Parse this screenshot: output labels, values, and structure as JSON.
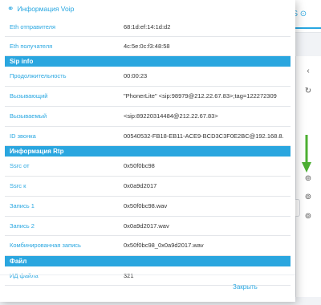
{
  "background": {
    "tab_label": "2 S",
    "tab_icon": "gear-icon",
    "side_icons": [
      "chevron-left-icon",
      "refresh-icon",
      "help-icon",
      "help-icon",
      "help-icon"
    ]
  },
  "modal": {
    "title": "Информация Voip",
    "title_icon": "link-icon",
    "close_label": "Закрыть",
    "rows": [
      {
        "type": "row",
        "label": "Eth отправителя",
        "value": "68:1d:ef:14:1d:d2"
      },
      {
        "type": "row",
        "label": "Eth получателя",
        "value": "4c:5e:0c:f3:48:58"
      },
      {
        "type": "section",
        "label": "Sip info"
      },
      {
        "type": "row",
        "label": "Продолжительность",
        "value": "00:00:23"
      },
      {
        "type": "row",
        "label": "Вызывающий",
        "value": "\"PhonerLite\" <sip:98979@212.22.67.83>;tag=122272309"
      },
      {
        "type": "row",
        "label": "Вызываемый",
        "value": "<sip:89220314484@212.22.67.83>"
      },
      {
        "type": "row",
        "label": "ID звонка",
        "value": "00540532-FB18-EB11-ACE9-BCD3C3F0E2BC@192.168.8."
      },
      {
        "type": "section",
        "label": "Информация Rtp"
      },
      {
        "type": "row",
        "label": "Ssrc от",
        "value": "0x50f0bc98"
      },
      {
        "type": "row",
        "label": "Ssrc к",
        "value": "0x0a9d2017"
      },
      {
        "type": "row",
        "label": "Запись 1",
        "value": "0x50f0bc98.wav"
      },
      {
        "type": "row",
        "label": "Запись 2",
        "value": "0x0a9d2017.wav"
      },
      {
        "type": "row",
        "label": "Комбинированная запись",
        "value": "0x50f0bc98_0x0a9d2017.wav"
      },
      {
        "type": "section",
        "label": "Файл"
      },
      {
        "type": "row",
        "label": "ИД файла",
        "value": "321"
      }
    ]
  },
  "colors": {
    "accent": "#2aa6df",
    "arrow": "#4caf32"
  }
}
